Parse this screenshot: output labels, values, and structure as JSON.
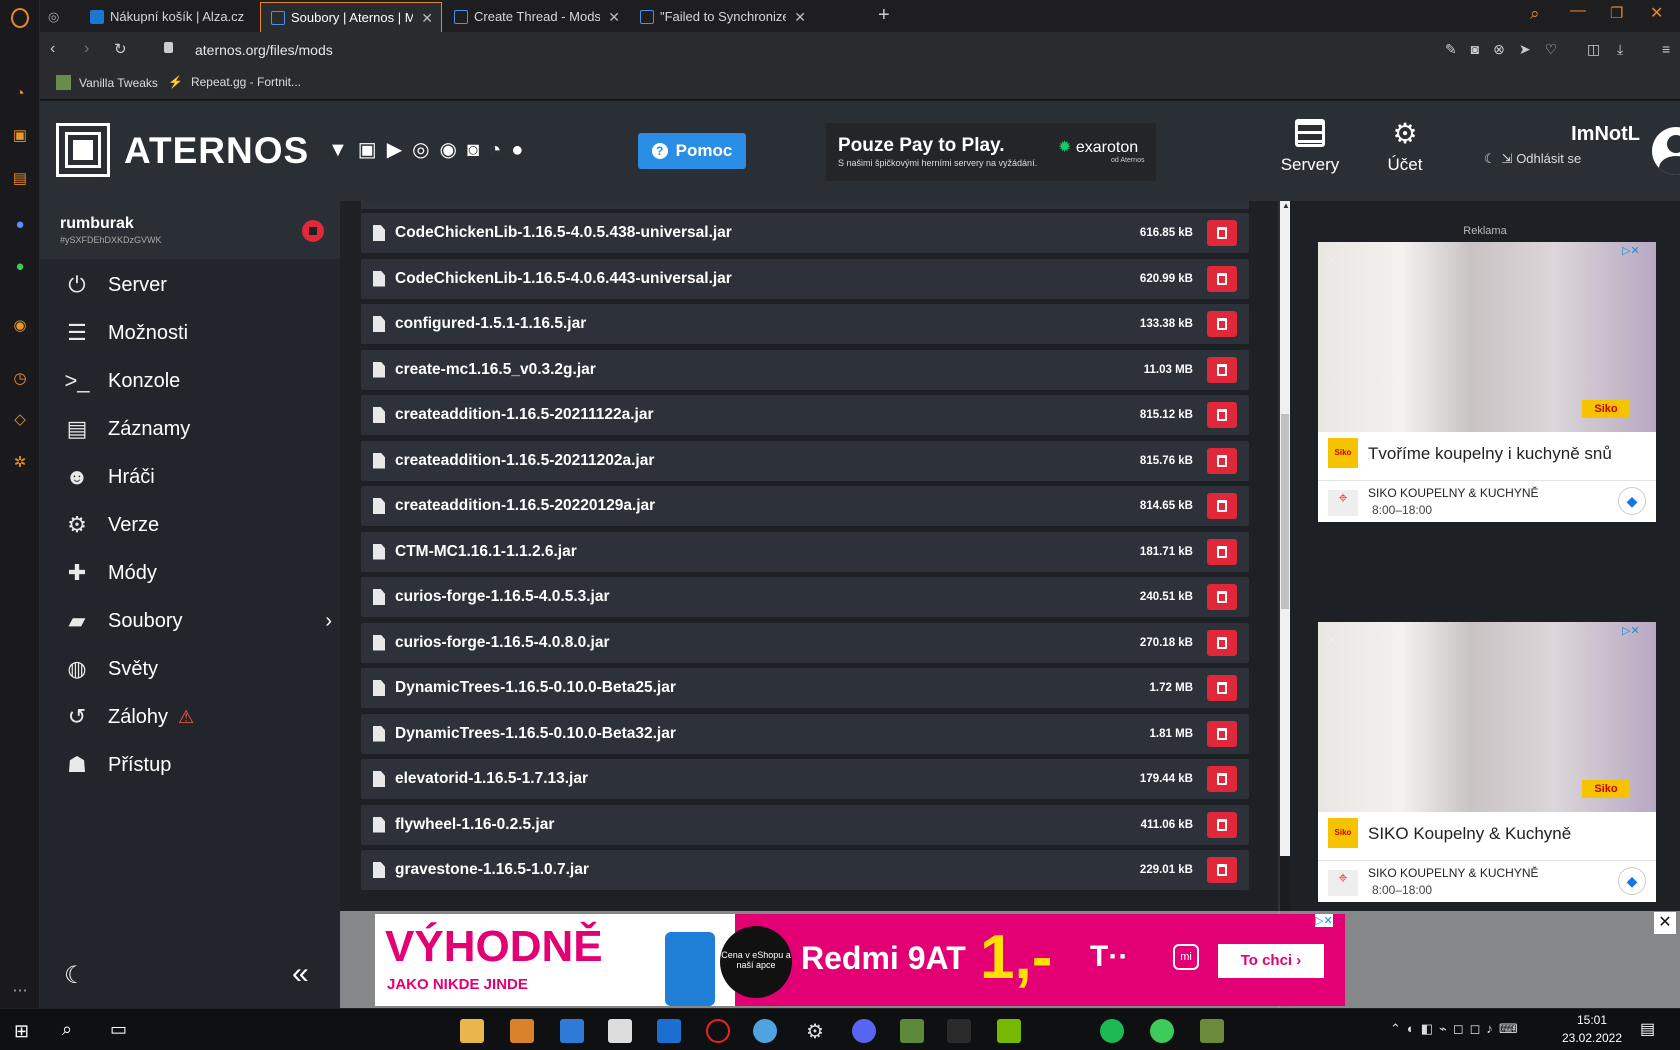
{
  "browser": {
    "tabs": [
      {
        "label": "Nákupní košík | Alza.cz"
      },
      {
        "label": "Soubory | Aternos | Minecraft"
      },
      {
        "label": "Create Thread - Mods/Mod"
      },
      {
        "label": "\"Failed to Synchronize regi"
      }
    ],
    "url": "aternos.org/files/mods",
    "bookmarks": [
      {
        "label": "Vanilla Tweaks"
      },
      {
        "label": "Repeat.gg - Fortnit..."
      }
    ]
  },
  "header": {
    "logo": "ATERNOS",
    "help_label": "Pomoc",
    "promo_title": "Pouze Pay to Play.",
    "promo_sub": "S našimi špičkovými herními servery na vyžádání.",
    "promo_brand": "exaroton",
    "promo_brand_sub": "od Aternos",
    "servers_label": "Servery",
    "account_label": "Účet",
    "username": "ImNotL",
    "logout_label": "Odhlásit se"
  },
  "server": {
    "name": "rumburak",
    "id": "#ySXFDEhDXKDzGVWK"
  },
  "nav": [
    {
      "label": "Server",
      "icon": "power-icon"
    },
    {
      "label": "Možnosti",
      "icon": "sliders-icon"
    },
    {
      "label": "Konzole",
      "icon": "terminal-icon"
    },
    {
      "label": "Záznamy",
      "icon": "document-icon"
    },
    {
      "label": "Hráči",
      "icon": "users-icon"
    },
    {
      "label": "Verze",
      "icon": "gears-icon"
    },
    {
      "label": "Módy",
      "icon": "puzzle-icon"
    },
    {
      "label": "Soubory",
      "icon": "folder-icon"
    },
    {
      "label": "Světy",
      "icon": "globe-icon"
    },
    {
      "label": "Zálohy",
      "icon": "history-icon"
    },
    {
      "label": "Přístup",
      "icon": "user-lock-icon"
    }
  ],
  "files": [
    {
      "name": "CodeChickenLib-1.16.5-4.0.5.438-universal.jar",
      "size": "616.85 kB"
    },
    {
      "name": "CodeChickenLib-1.16.5-4.0.6.443-universal.jar",
      "size": "620.99 kB"
    },
    {
      "name": "configured-1.5.1-1.16.5.jar",
      "size": "133.38 kB"
    },
    {
      "name": "create-mc1.16.5_v0.3.2g.jar",
      "size": "11.03 MB"
    },
    {
      "name": "createaddition-1.16.5-20211122a.jar",
      "size": "815.12 kB"
    },
    {
      "name": "createaddition-1.16.5-20211202a.jar",
      "size": "815.76 kB"
    },
    {
      "name": "createaddition-1.16.5-20220129a.jar",
      "size": "814.65 kB"
    },
    {
      "name": "CTM-MC1.16.1-1.1.2.6.jar",
      "size": "181.71 kB"
    },
    {
      "name": "curios-forge-1.16.5-4.0.5.3.jar",
      "size": "240.51 kB"
    },
    {
      "name": "curios-forge-1.16.5-4.0.8.0.jar",
      "size": "270.18 kB"
    },
    {
      "name": "DynamicTrees-1.16.5-0.10.0-Beta25.jar",
      "size": "1.72 MB"
    },
    {
      "name": "DynamicTrees-1.16.5-0.10.0-Beta32.jar",
      "size": "1.81 MB"
    },
    {
      "name": "elevatorid-1.16.5-1.7.13.jar",
      "size": "179.44 kB"
    },
    {
      "name": "flywheel-1.16-0.2.5.jar",
      "size": "411.06 kB"
    },
    {
      "name": "gravestone-1.16.5-1.0.7.jar",
      "size": "229.01 kB"
    }
  ],
  "ads": {
    "label": "Reklama",
    "ad1_title": "Tvoříme koupelny i kuchyně snů",
    "ad2_title": "SIKO Koupelny & Kuchyně",
    "place": "SIKO KOUPELNY & KUCHYNĚ",
    "hours": "8:00–18:00",
    "brand": "Siko"
  },
  "banner": {
    "headline": "VÝHODNĚ",
    "sub": "JAKO NIKDE JINDE",
    "badge": "Cena v eShopu a naší apce",
    "product": "Redmi 9AT",
    "price": "1,-",
    "cta": "To chci"
  },
  "taskbar": {
    "time": "15:01",
    "date": "23.02.2022"
  },
  "colors": {
    "accent": "#e5862b",
    "delete": "#e0283a",
    "help": "#2b8ee6",
    "banner_pink": "#e20074"
  }
}
